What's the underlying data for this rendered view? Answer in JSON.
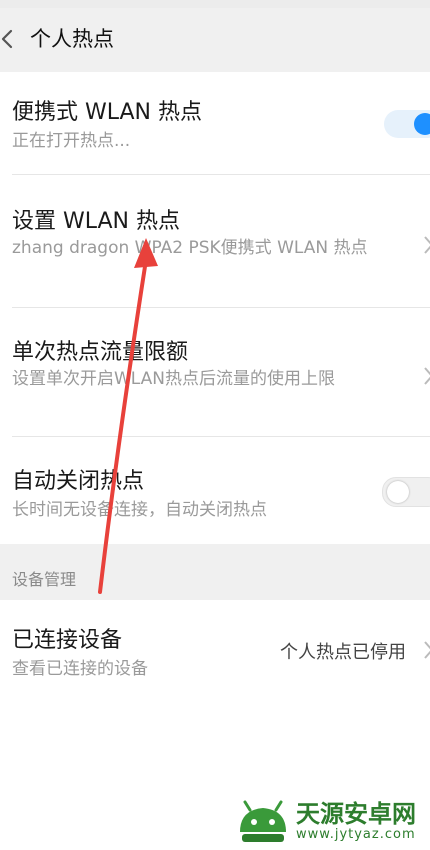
{
  "header": {
    "title": "个人热点"
  },
  "items": [
    {
      "label": "便携式 WLAN 热点",
      "sub": "正在打开热点...",
      "toggle": "on"
    },
    {
      "label": "设置 WLAN 热点",
      "sub": "zhang dragon  WPA2 PSK便携式 WLAN 热点"
    },
    {
      "label": "单次热点流量限额",
      "sub": "设置单次开启WLAN热点后流量的使用上限"
    },
    {
      "label": "自动关闭热点",
      "sub": "长时间无设备连接，自动关闭热点",
      "toggle": "off"
    }
  ],
  "section": {
    "title": "设备管理"
  },
  "connected": {
    "label": "已连接设备",
    "sub": "查看已连接的设备",
    "status": "个人热点已停用"
  },
  "watermark": {
    "title": "天源安卓网",
    "url": "www.jytyaz.com"
  },
  "colors": {
    "accent": "#1e90ff",
    "annotation_arrow": "#e8413b",
    "watermark": "#2d7d2d"
  }
}
